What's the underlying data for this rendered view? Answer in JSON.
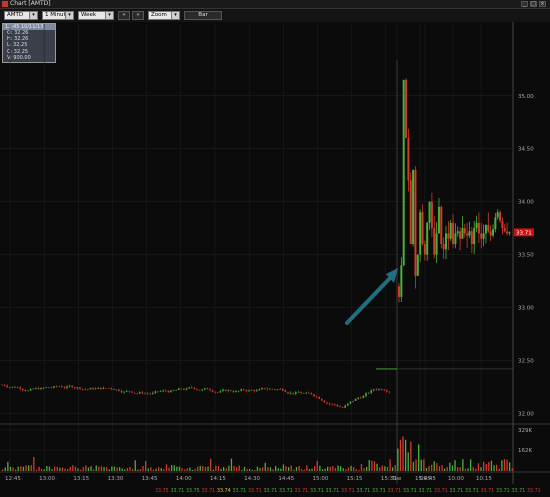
{
  "window": {
    "title": "Chart [AMTD]",
    "controls": [
      "_",
      "□",
      "×"
    ]
  },
  "toolbar": {
    "symbol": "AMTD",
    "interval": "1 Minute",
    "period": "Week",
    "back_label": "«",
    "forward_label": "»",
    "zoom": "Zoom",
    "chart_type": "Bar"
  },
  "ohlc": {
    "header": "12:45 10/11/13",
    "open": "O: 32.26",
    "high": "H: 32.26",
    "low": "L: 32.25",
    "close": "C: 32.25",
    "volume": "V: 900.00"
  },
  "price_axis": {
    "ticks": [
      "35.00",
      "34.50",
      "34.00",
      "33.50",
      "33.00",
      "32.50",
      "32.00"
    ],
    "last_price": "33.71"
  },
  "volume_axis": {
    "ticks": [
      "329K",
      "162K"
    ]
  },
  "time_axis": {
    "ticks": [
      "12:45",
      "13:00",
      "13:15",
      "13:30",
      "13:45",
      "14:00",
      "14:15",
      "14:30",
      "14:45",
      "15:00",
      "15:15",
      "15:30",
      "15:45",
      "Tue",
      "09:45",
      "10:00",
      "10:15"
    ]
  },
  "bottom_strip": {
    "items": [
      "33.75",
      "33.71",
      "33.75",
      "33.71",
      "33.74",
      "33.71",
      "33.71",
      "33.71",
      "33.71",
      "33.71",
      "33.71",
      "33.71",
      "33.71",
      "33.71",
      "33.71",
      "33.71",
      "33.71",
      "33.71",
      "33.71",
      "33.71",
      "33.71",
      "33.71",
      "33.71",
      "33.71",
      "33.71"
    ]
  },
  "colors": {
    "up": "#4caf3a",
    "down": "#d43a2a",
    "arrow": "#1f6f80",
    "grid": "#222222",
    "last_price_bg": "#cc1111"
  },
  "chart_data": {
    "type": "candlestick",
    "ylim": [
      31.9,
      35.3
    ],
    "prior_session_level": 32.25,
    "session_close_level": 32.42,
    "open_spike_high": 35.15,
    "open_spike_low": 33.05,
    "last": 33.71,
    "annotation": "arrow pointing at market open gap"
  }
}
